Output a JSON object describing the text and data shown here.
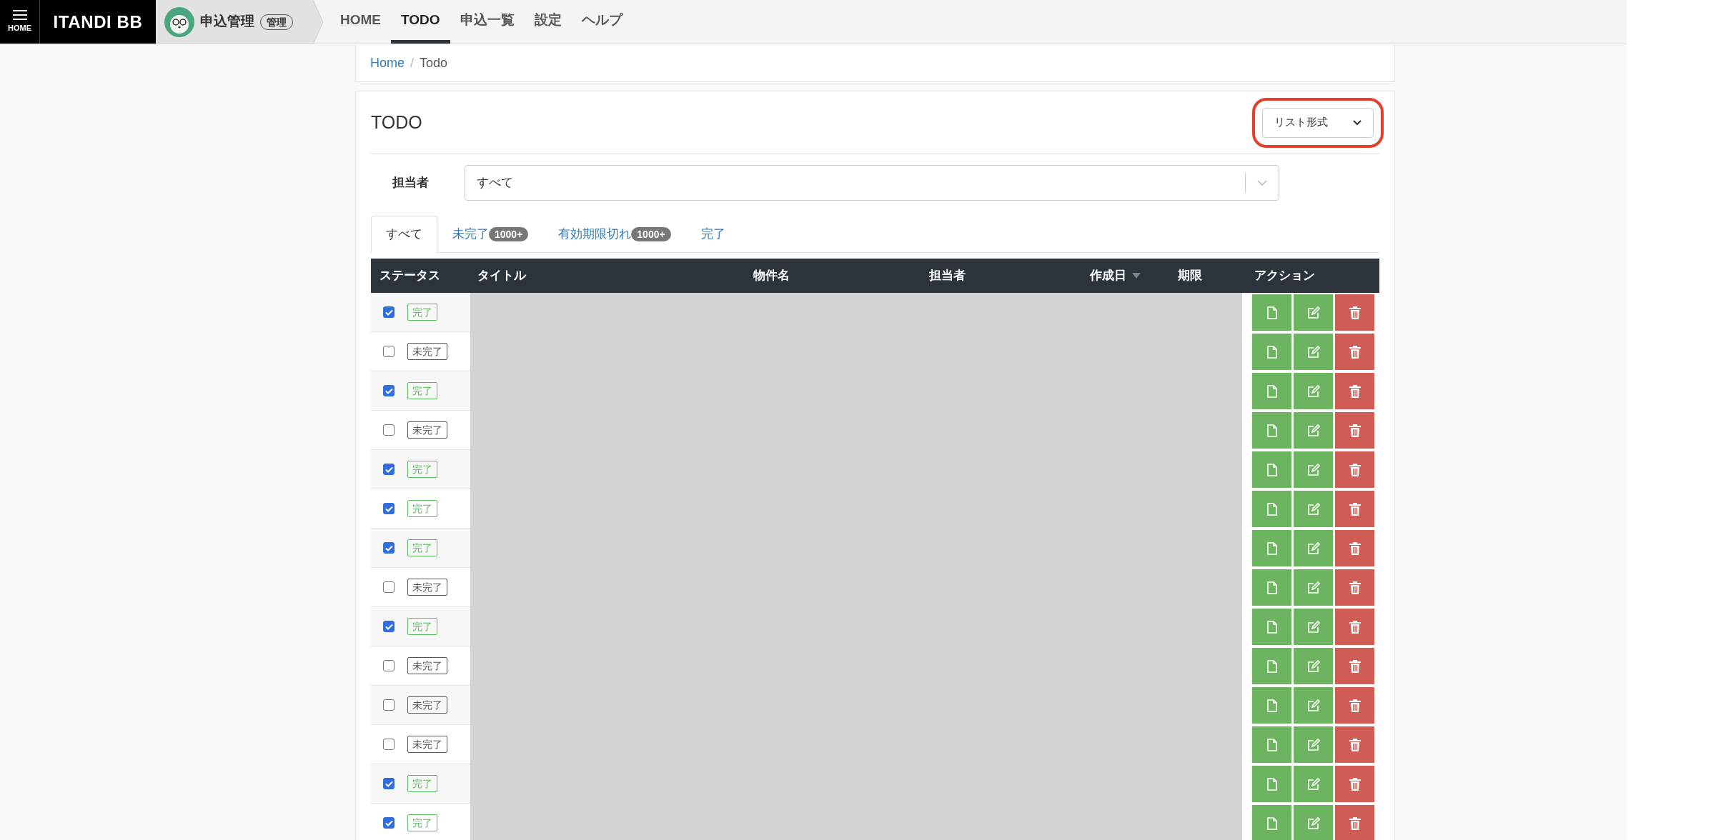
{
  "header": {
    "menu_label": "HOME",
    "logo": "ITANDI BB",
    "app": {
      "name": "申込管理",
      "role": "管理"
    },
    "nav": [
      {
        "label": "HOME",
        "selected": false
      },
      {
        "label": "TODO",
        "selected": true
      },
      {
        "label": "申込一覧",
        "selected": false
      },
      {
        "label": "設定",
        "selected": false
      },
      {
        "label": "ヘルプ",
        "selected": false
      }
    ]
  },
  "breadcrumb": [
    {
      "label": "Home",
      "kind": "link"
    },
    {
      "separator": "/",
      "label": "Todo",
      "kind": "current"
    }
  ],
  "panel": {
    "title": "TODO",
    "view_select": {
      "value": "リスト形式",
      "highlighted": true
    },
    "filter": {
      "label": "担当者",
      "value": "すべて"
    },
    "tabs": [
      {
        "label": "すべて",
        "selected": true
      },
      {
        "label": "未完了",
        "badge": "1000+",
        "selected": false
      },
      {
        "label": "有効期限切れ",
        "badge": "1000+",
        "selected": false
      },
      {
        "label": "完了",
        "selected": false
      }
    ],
    "table": {
      "columns": [
        {
          "label": "ステータス",
          "sorted": false
        },
        {
          "label": "タイトル",
          "sorted": false
        },
        {
          "label": "物件名",
          "sorted": false
        },
        {
          "label": "担当者",
          "sorted": false
        },
        {
          "label": "作成日",
          "sorted": true
        },
        {
          "label": "期限",
          "sorted": false
        },
        {
          "label": "アクション",
          "sorted": false
        }
      ],
      "rows": [
        {
          "checked": true,
          "status": "完了",
          "kind": "done"
        },
        {
          "checked": false,
          "status": "未完了",
          "kind": "open"
        },
        {
          "checked": true,
          "status": "完了",
          "kind": "done"
        },
        {
          "checked": false,
          "status": "未完了",
          "kind": "open"
        },
        {
          "checked": true,
          "status": "完了",
          "kind": "done"
        },
        {
          "checked": true,
          "status": "完了",
          "kind": "done"
        },
        {
          "checked": true,
          "status": "完了",
          "kind": "done"
        },
        {
          "checked": false,
          "status": "未完了",
          "kind": "open"
        },
        {
          "checked": true,
          "status": "完了",
          "kind": "done"
        },
        {
          "checked": false,
          "status": "未完了",
          "kind": "open"
        },
        {
          "checked": false,
          "status": "未完了",
          "kind": "open"
        },
        {
          "checked": false,
          "status": "未完了",
          "kind": "open"
        },
        {
          "checked": true,
          "status": "完了",
          "kind": "done"
        },
        {
          "checked": true,
          "status": "完了",
          "kind": "done"
        }
      ]
    }
  }
}
